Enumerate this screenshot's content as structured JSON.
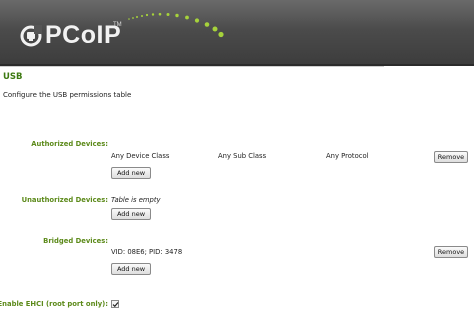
{
  "header": {
    "logo_text": "PCoIP",
    "logo_tm": "TM"
  },
  "page": {
    "title": "USB",
    "subtitle": "Configure the USB permissions table"
  },
  "authorized": {
    "label": "Authorized Devices:",
    "row": {
      "device_class": "Any Device Class",
      "sub_class": "Any Sub Class",
      "protocol": "Any Protocol"
    },
    "remove_label": "Remove",
    "add_label": "Add new"
  },
  "unauthorized": {
    "label": "Unauthorized Devices:",
    "empty_text": "Table is empty",
    "add_label": "Add new"
  },
  "bridged": {
    "label": "Bridged Devices:",
    "row": {
      "vid_pid": "VID: 08E6; PID: 3478"
    },
    "remove_label": "Remove",
    "add_label": "Add new"
  },
  "ehci": {
    "label": "Enable EHCI (root port only):",
    "checked": true
  },
  "colors": {
    "header_bg": "#4b4b4b",
    "accent_green": "#5c8a1a",
    "title_green": "#3d7a12"
  }
}
